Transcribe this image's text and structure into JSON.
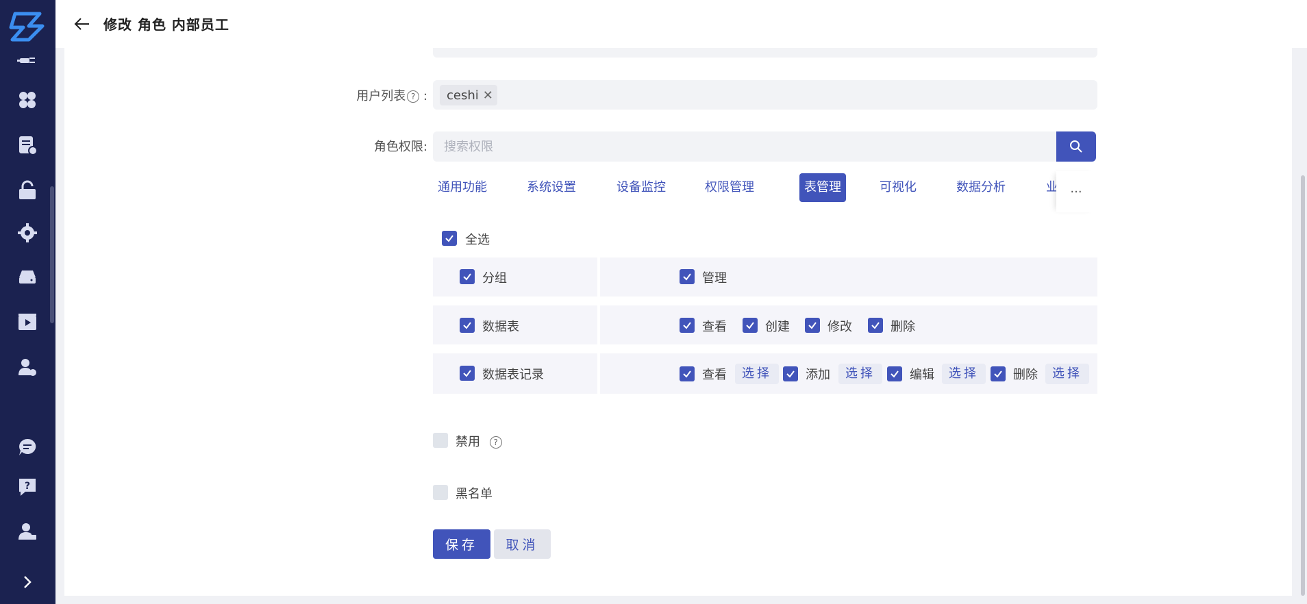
{
  "header": {
    "title": "修改 角色 内部员工"
  },
  "sidebar": {
    "icons": [
      "plug-icon",
      "apps-icon",
      "document-settings-icon",
      "lock-icon",
      "gear-icon",
      "storage-icon",
      "video-icon",
      "user-settings-icon",
      "chat-icon",
      "help-icon",
      "user-admin-icon",
      "expand-icon"
    ]
  },
  "form": {
    "user_list_label": "用户列表",
    "user_tag": "ceshi",
    "role_perm_label": "角色权限",
    "search_placeholder": "搜索权限",
    "tabs": [
      "通用功能",
      "系统设置",
      "设备监控",
      "权限管理",
      "表管理",
      "可视化",
      "数据分析",
      "业"
    ],
    "active_tab": "表管理",
    "tabs_more": "···",
    "select_all": "全选",
    "groups": [
      {
        "name": "分组",
        "checked": true,
        "perms": [
          {
            "label": "管理",
            "checked": true
          }
        ]
      },
      {
        "name": "数据表",
        "checked": true,
        "perms": [
          {
            "label": "查看",
            "checked": true
          },
          {
            "label": "创建",
            "checked": true
          },
          {
            "label": "修改",
            "checked": true
          },
          {
            "label": "删除",
            "checked": true
          }
        ]
      },
      {
        "name": "数据表记录",
        "checked": true,
        "perms": [
          {
            "label": "查看",
            "checked": true,
            "select": "选择"
          },
          {
            "label": "添加",
            "checked": true,
            "select": "选择"
          },
          {
            "label": "编辑",
            "checked": true,
            "select": "选择"
          },
          {
            "label": "删除",
            "checked": true,
            "select": "选择"
          }
        ]
      }
    ],
    "disable_label": "禁用",
    "disable_checked": false,
    "blacklist_label": "黑名单",
    "blacklist_checked": false,
    "save_label": "保存",
    "cancel_label": "取消"
  },
  "colors": {
    "accent": "#4154ba",
    "sidebar": "#1b2250"
  }
}
